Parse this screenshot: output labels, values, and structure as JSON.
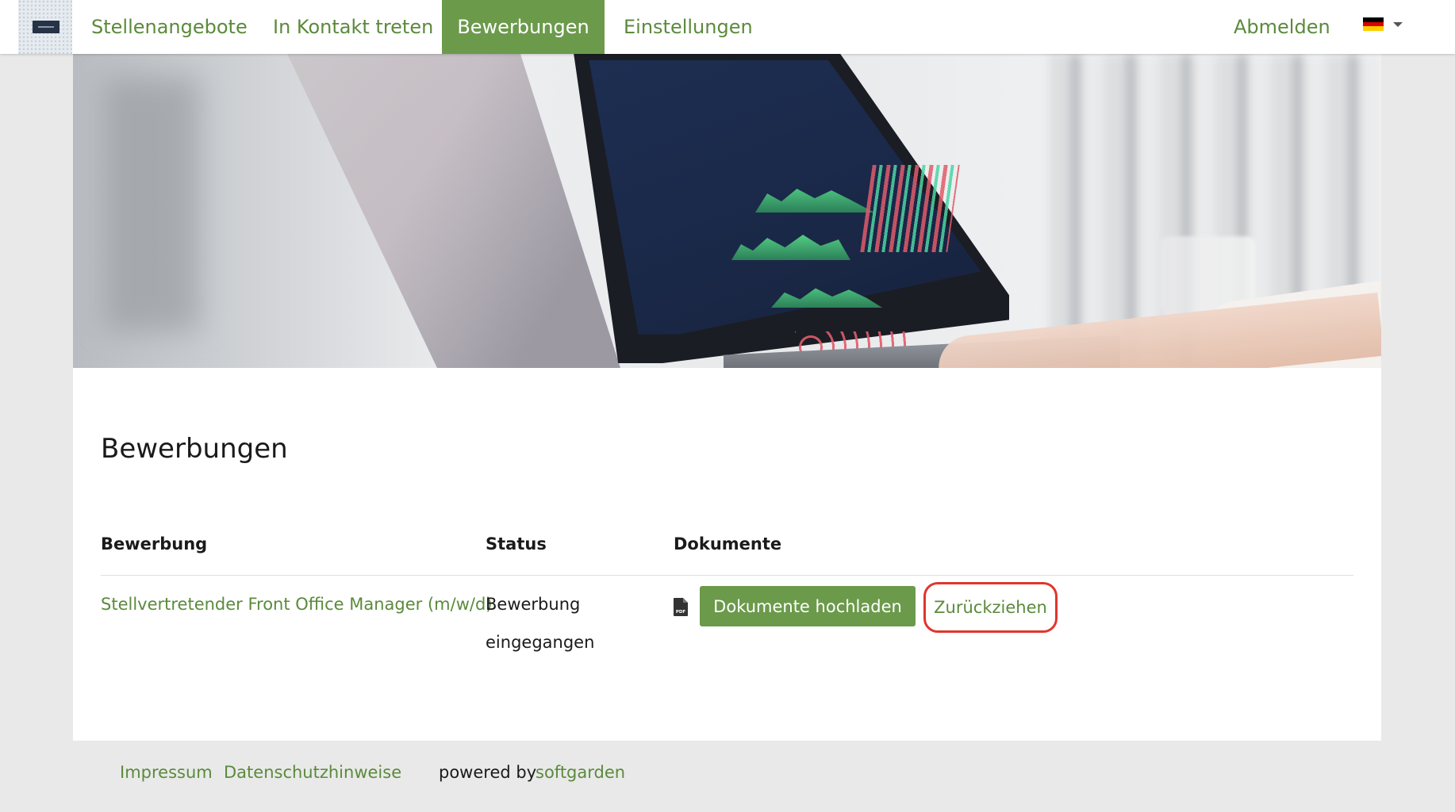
{
  "nav": {
    "items": [
      {
        "label": "Stellenangebote"
      },
      {
        "label": "In Kontakt treten"
      },
      {
        "label": "Bewerbungen"
      },
      {
        "label": "Einstellungen"
      }
    ],
    "logout": "Abmelden",
    "language_flag": "german-flag-icon"
  },
  "page": {
    "title": "Bewerbungen"
  },
  "table": {
    "headers": {
      "application": "Bewerbung",
      "status": "Status",
      "documents": "Dokumente"
    },
    "rows": [
      {
        "job_title": "Stellvertretender Front Office Manager (m/w/d)",
        "status": "Bewerbung eingegangen",
        "document_icon": "pdf-file-icon",
        "upload_label": "Dokumente hochladen",
        "withdraw_label": "Zurückziehen"
      }
    ]
  },
  "footer": {
    "imprint": "Impressum",
    "privacy": "Datenschutzhinweise",
    "powered_by": "powered by",
    "brand": "softgarden"
  },
  "colors": {
    "accent_green": "#6b9a4b",
    "link_green": "#5b8a3c",
    "highlight_red": "#e0362c",
    "background": "#e9e9e9"
  }
}
